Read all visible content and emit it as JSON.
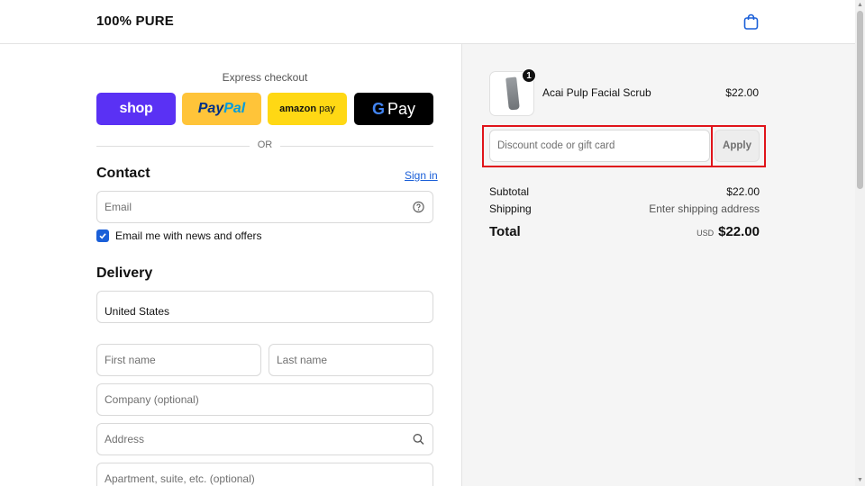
{
  "header": {
    "brand": "100% PURE",
    "cart_icon": "shopping-bag-icon"
  },
  "express": {
    "label": "Express checkout",
    "buttons": {
      "shop": "shop",
      "paypal_pay": "Pay",
      "paypal_pal": "Pal",
      "amazon_brand": "amazon",
      "amazon_pay": "pay",
      "gpay_g": "G",
      "gpay_pay": "Pay"
    },
    "or": "OR"
  },
  "contact": {
    "title": "Contact",
    "signin": "Sign in",
    "email_placeholder": "Email",
    "news_label": "Email me with news and offers",
    "news_checked": true
  },
  "delivery": {
    "title": "Delivery",
    "country": "United States",
    "first_name": "First name",
    "last_name": "Last name",
    "company": "Company (optional)",
    "address": "Address",
    "apartment": "Apartment, suite, etc. (optional)"
  },
  "summary": {
    "product": {
      "name": "Acai Pulp Facial Scrub",
      "price": "$22.00",
      "qty": "1"
    },
    "discount_placeholder": "Discount code or gift card",
    "apply": "Apply",
    "subtotal_label": "Subtotal",
    "subtotal": "$22.00",
    "shipping_label": "Shipping",
    "shipping": "Enter shipping address",
    "total_label": "Total",
    "currency": "USD",
    "total": "$22.00"
  },
  "colors": {
    "accent": "#1a5fd8",
    "highlight": "#e0141a",
    "shop": "#5a31f4",
    "paypal": "#ffc439",
    "amazon": "#ffd814"
  }
}
